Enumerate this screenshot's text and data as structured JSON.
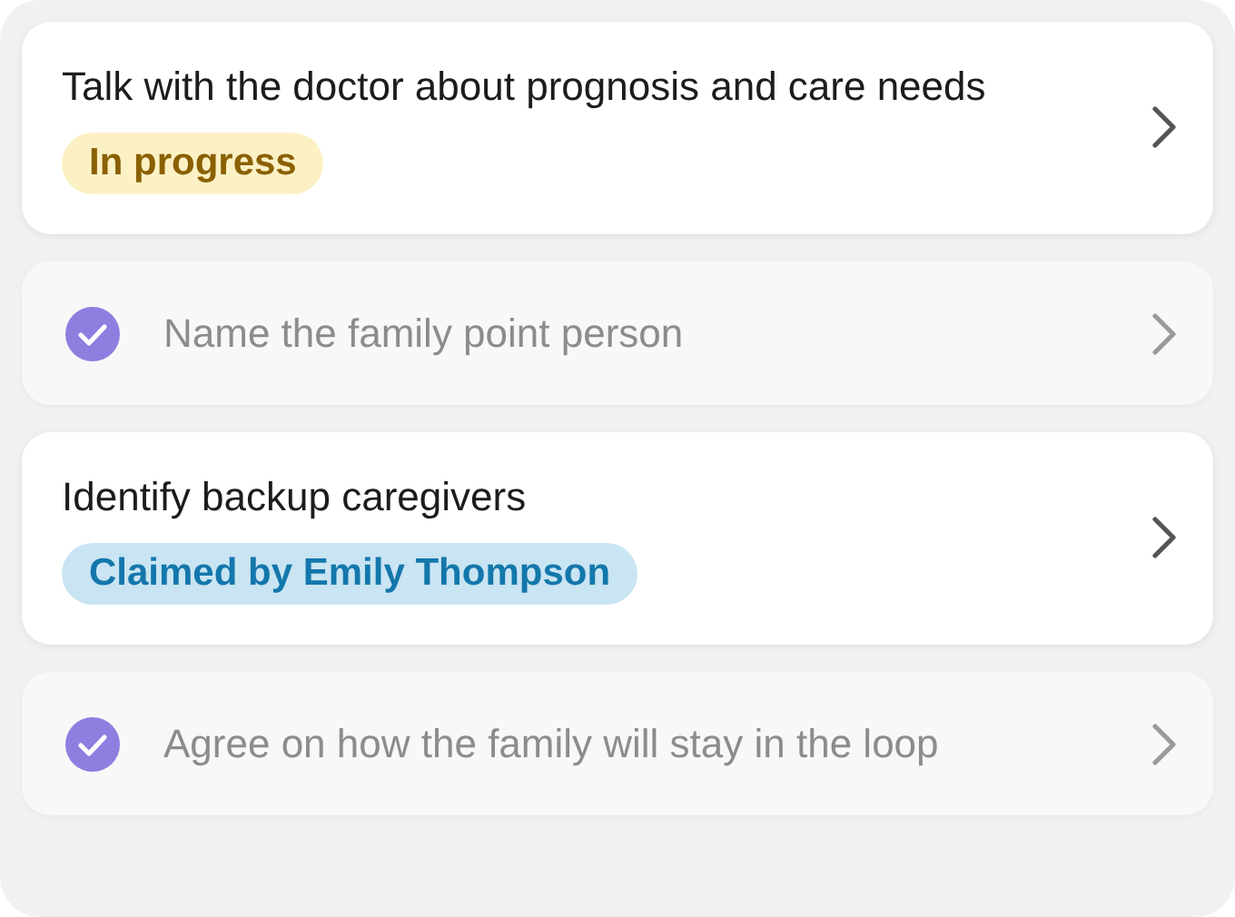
{
  "tasks": [
    {
      "title": "Talk with the doctor about prognosis and care needs",
      "done": false,
      "badge": {
        "kind": "progress",
        "text": "In progress"
      }
    },
    {
      "title": "Name the family point person",
      "done": true
    },
    {
      "title": "Identify backup caregivers",
      "done": false,
      "badge": {
        "kind": "claimed",
        "text": "Claimed by Emily Thompson"
      }
    },
    {
      "title": "Agree on how the family will stay in the loop",
      "done": true
    }
  ]
}
